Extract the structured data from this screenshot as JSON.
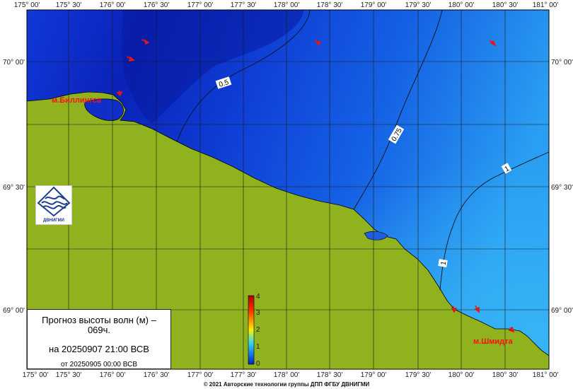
{
  "map": {
    "lon_labels": [
      "175° 00'",
      "175° 30'",
      "176° 00'",
      "176° 30'",
      "177° 00'",
      "177° 30'",
      "178° 00'",
      "178° 30'",
      "179° 00'",
      "179° 30'",
      "180° 00'",
      "180° 30'",
      "181° 00'"
    ],
    "lat_labels": [
      "70° 00'",
      "69° 30'",
      "69° 00'"
    ],
    "isolines": [
      {
        "value": "0.5"
      },
      {
        "value": "0.75"
      },
      {
        "value": "1"
      },
      {
        "value": "1"
      }
    ],
    "places": [
      {
        "name": "м.Биллингса"
      },
      {
        "name": "м.Шмидта"
      }
    ],
    "colors": {
      "land": "#8fb21e",
      "sea_low": "#0a28c8",
      "sea_high": "#1e8ff0",
      "arrow": "#e01818"
    }
  },
  "legend": {
    "ticks": [
      "4",
      "3",
      "2",
      "1",
      "0"
    ],
    "gradient": [
      "#b00000",
      "#ff2a00",
      "#ff9d00",
      "#fff200",
      "#3fd9e8",
      "#1a8cf0",
      "#0022c8"
    ]
  },
  "info": {
    "line1": "Прогноз высоты волн (м) – 069ч.",
    "line2": "на 20250907 21:00 ВСВ",
    "line3": "от 20250905 00:00 ВСВ"
  },
  "logo": {
    "name": "ДВНИГМИ"
  },
  "footer": {
    "copyright": "© 2021 Авторские технологии группы ДПП ФГБУ ДВНИГМИ"
  }
}
